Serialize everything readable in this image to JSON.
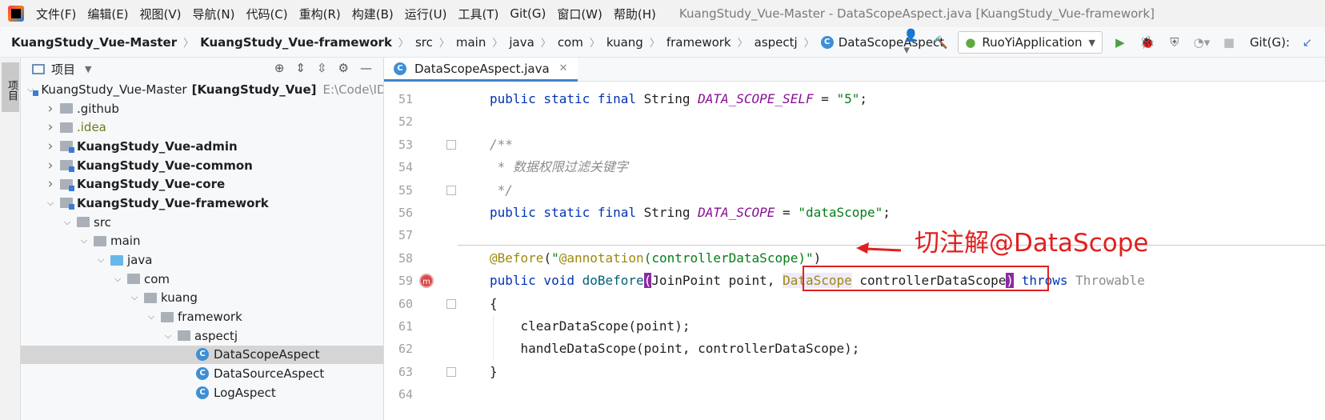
{
  "menubar": {
    "items": [
      "文件(F)",
      "编辑(E)",
      "视图(V)",
      "导航(N)",
      "代码(C)",
      "重构(R)",
      "构建(B)",
      "运行(U)",
      "工具(T)",
      "Git(G)",
      "窗口(W)",
      "帮助(H)"
    ],
    "window_title": "KuangStudy_Vue-Master - DataScopeAspect.java [KuangStudy_Vue-framework]"
  },
  "breadcrumb": {
    "items": [
      "KuangStudy_Vue-Master",
      "KuangStudy_Vue-framework",
      "src",
      "main",
      "java",
      "com",
      "kuang",
      "framework",
      "aspectj",
      "DataScopeAspect"
    ]
  },
  "toolbar": {
    "run_config": "RuoYiApplication",
    "git_label": "Git(G):"
  },
  "left_strip": {
    "project_tab": "项目"
  },
  "project_panel": {
    "title": "项目",
    "tree": [
      {
        "depth": 0,
        "arrow": "open",
        "icon": "module",
        "label": "KuangStudy_Vue-Master",
        "bold_suffix": "[KuangStudy_Vue]",
        "path": "E:\\Code\\IDEA"
      },
      {
        "depth": 1,
        "arrow": "closed",
        "icon": "folder",
        "label": ".github"
      },
      {
        "depth": 1,
        "arrow": "closed",
        "icon": "folder",
        "label": ".idea",
        "style": "olive"
      },
      {
        "depth": 1,
        "arrow": "closed",
        "icon": "module",
        "label": "KuangStudy_Vue-admin",
        "style": "bold"
      },
      {
        "depth": 1,
        "arrow": "closed",
        "icon": "module",
        "label": "KuangStudy_Vue-common",
        "style": "bold"
      },
      {
        "depth": 1,
        "arrow": "closed",
        "icon": "module",
        "label": "KuangStudy_Vue-core",
        "style": "bold"
      },
      {
        "depth": 1,
        "arrow": "open",
        "icon": "module",
        "label": "KuangStudy_Vue-framework",
        "style": "bold"
      },
      {
        "depth": 2,
        "arrow": "open",
        "icon": "folder",
        "label": "src"
      },
      {
        "depth": 3,
        "arrow": "open",
        "icon": "folder",
        "label": "main"
      },
      {
        "depth": 4,
        "arrow": "open",
        "icon": "folder-blue",
        "label": "java"
      },
      {
        "depth": 5,
        "arrow": "open",
        "icon": "package",
        "label": "com"
      },
      {
        "depth": 6,
        "arrow": "open",
        "icon": "package",
        "label": "kuang"
      },
      {
        "depth": 7,
        "arrow": "open",
        "icon": "package",
        "label": "framework"
      },
      {
        "depth": 8,
        "arrow": "open",
        "icon": "package",
        "label": "aspectj"
      },
      {
        "depth": 9,
        "arrow": "none",
        "icon": "class",
        "label": "DataScopeAspect",
        "selected": true
      },
      {
        "depth": 9,
        "arrow": "none",
        "icon": "class",
        "label": "DataSourceAspect"
      },
      {
        "depth": 9,
        "arrow": "none",
        "icon": "class",
        "label": "LogAspect"
      }
    ]
  },
  "editor": {
    "tab_label": "DataScopeAspect.java",
    "line_numbers": [
      "51",
      "52",
      "53",
      "54",
      "55",
      "56",
      "57",
      "58",
      "59",
      "60",
      "61",
      "62",
      "63",
      "64"
    ],
    "code": {
      "l51_kw": "public static final ",
      "l51_type": "String ",
      "l51_field": "DATA_SCOPE_SELF",
      "l51_eq": " = ",
      "l51_str": "\"5\"",
      "l51_end": ";",
      "l53": "/**",
      "l54": " * 数据权限过滤关键字",
      "l55": " */",
      "l56_kw": "public static final ",
      "l56_type": "String ",
      "l56_field": "DATA_SCOPE",
      "l56_eq": " = ",
      "l56_str": "\"dataScope\"",
      "l56_end": ";",
      "l58_ann": "@Before",
      "l58_open": "(",
      "l58_str1": "\"",
      "l58_ann2": "@annotation",
      "l58_str2": "(controllerDataScope)\"",
      "l58_close": ")",
      "l59_kw": "public void ",
      "l59_mth": "doBefore",
      "l59_p1": "(",
      "l59_args": "JoinPoint point, ",
      "l59_type": "DataScope",
      "l59_arg2": " controllerDataScope",
      "l59_p2": ")",
      "l59_throws": " throws ",
      "l59_exc": "Throwable",
      "l60": "{",
      "l61": "    clearDataScope(point);",
      "l62": "    handleDataScope(point, controllerDataScope);",
      "l63": "}"
    }
  },
  "annotation": {
    "text": "切注解@DataScope",
    "color": "#e02020"
  }
}
